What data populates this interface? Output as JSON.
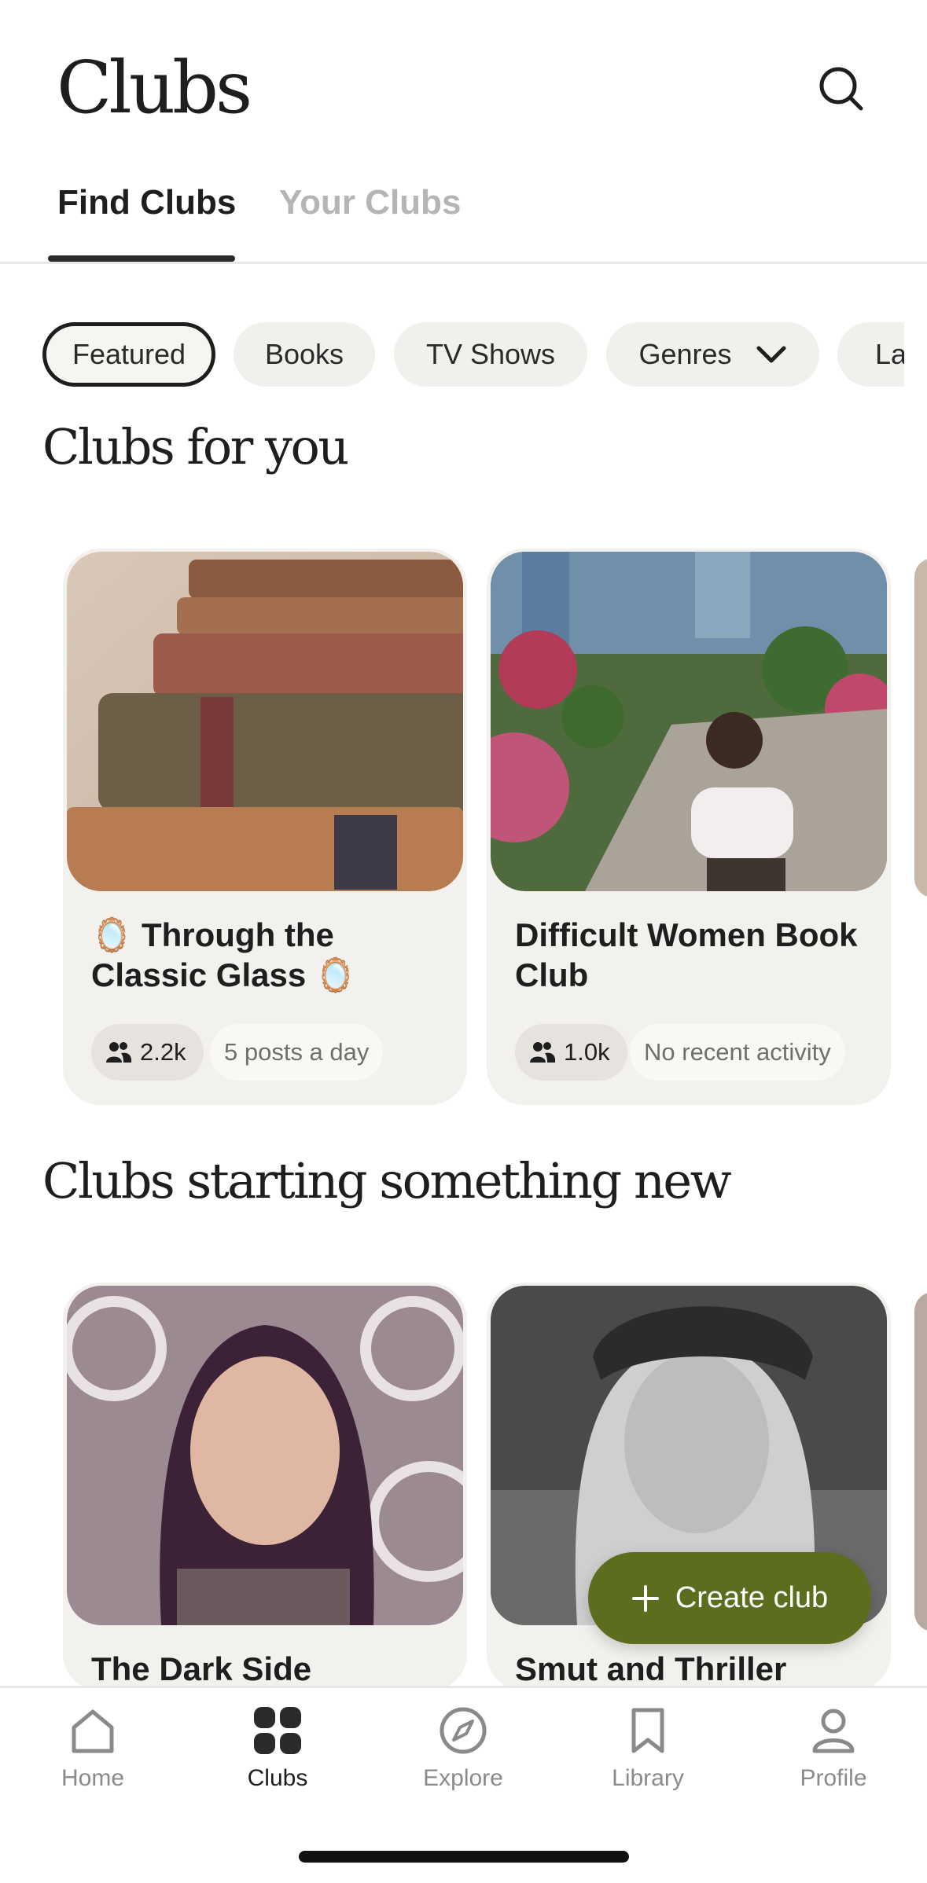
{
  "header": {
    "title": "Clubs",
    "search_icon": "search-icon"
  },
  "tabs": [
    {
      "label": "Find Clubs",
      "active": true
    },
    {
      "label": "Your Clubs",
      "active": false
    }
  ],
  "filters": [
    {
      "label": "Featured",
      "selected": true
    },
    {
      "label": "Books"
    },
    {
      "label": "TV Shows"
    },
    {
      "label": "Genres",
      "icon": "chevron-down-icon"
    },
    {
      "label": "La"
    }
  ],
  "sections": [
    {
      "title": "Clubs for you",
      "clubs": [
        {
          "name": "🪞 Through the Classic Glass 🪞",
          "members": "2.2k",
          "activity": "5 posts a day"
        },
        {
          "name": "Difficult Women Book Club",
          "members": "1.0k",
          "activity": "No recent activity"
        }
      ]
    },
    {
      "title": "Clubs starting something new",
      "clubs": [
        {
          "name": "The Dark Side"
        },
        {
          "name": "Smut and Thriller"
        }
      ]
    }
  ],
  "create_button": {
    "label": "Create club",
    "color": "#5d6d1e"
  },
  "nav": [
    {
      "label": "Home",
      "icon": "home-icon"
    },
    {
      "label": "Clubs",
      "icon": "clubs-grid-icon",
      "active": true
    },
    {
      "label": "Explore",
      "icon": "compass-icon"
    },
    {
      "label": "Library",
      "icon": "bookmark-icon"
    },
    {
      "label": "Profile",
      "icon": "person-icon"
    }
  ]
}
